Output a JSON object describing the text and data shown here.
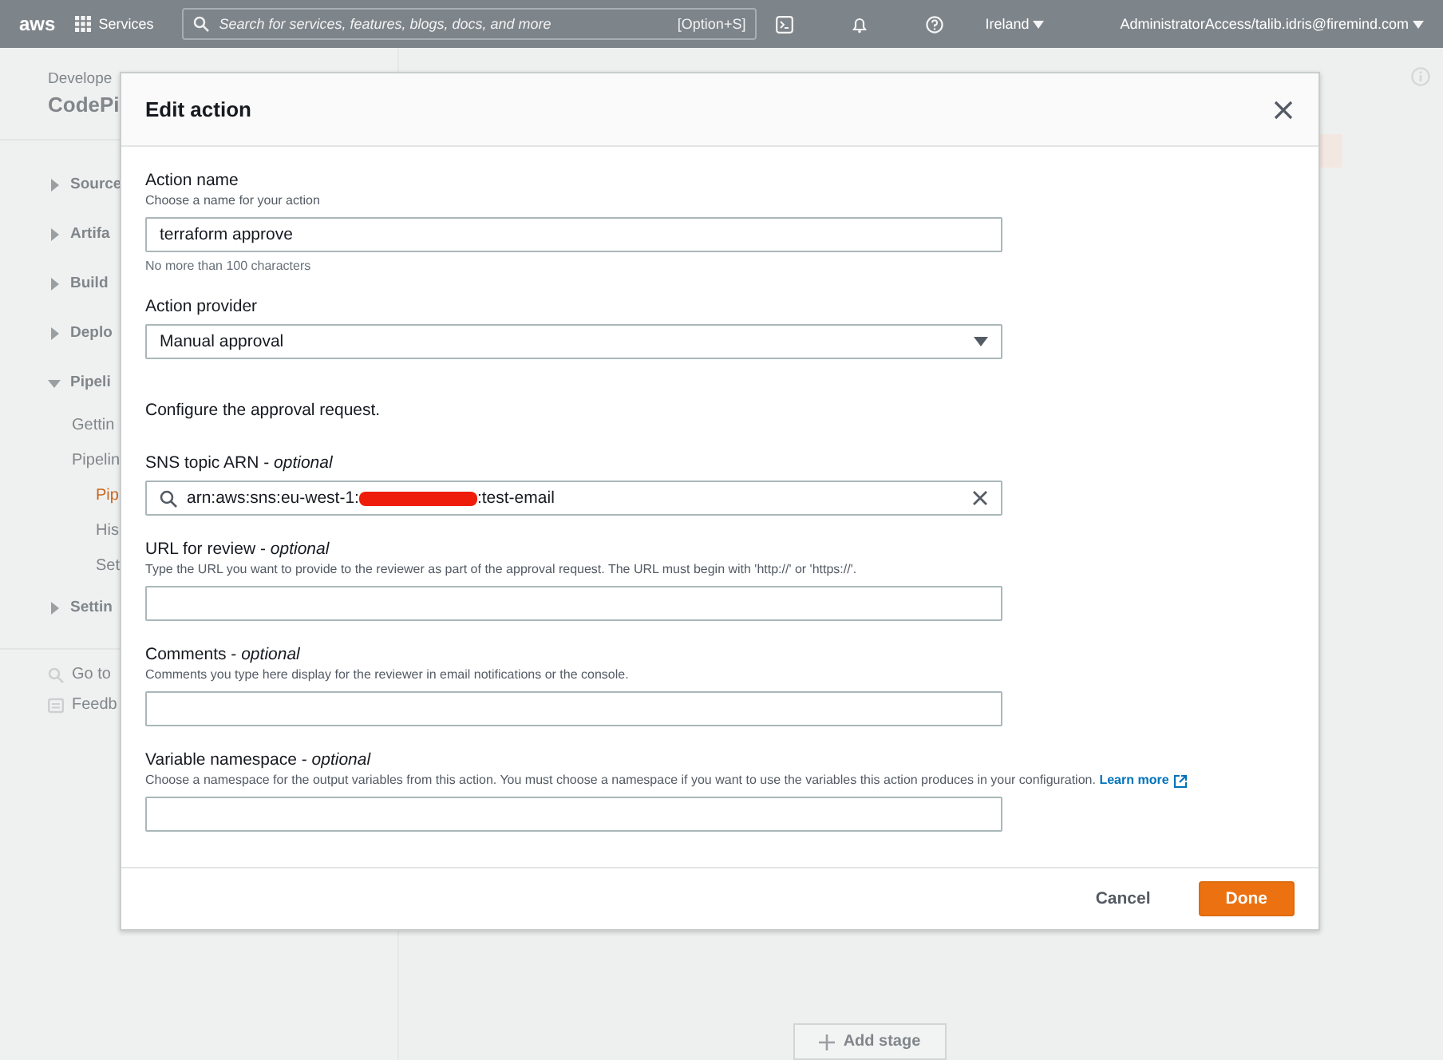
{
  "top_bar": {
    "logo": "aws",
    "services": "Services",
    "search_placeholder": "Search for services, features, blogs, docs, and more",
    "search_shortcut": "[Option+S]",
    "region": "Ireland",
    "account": "AdministratorAccess/talib.idris@firemind.com"
  },
  "sidebar": {
    "service": "Develope",
    "title": "CodePi",
    "items": [
      {
        "label": "Source",
        "expanded": false
      },
      {
        "label": "Artifa",
        "expanded": false
      },
      {
        "label": "Build",
        "expanded": false
      },
      {
        "label": "Deplo",
        "expanded": false
      },
      {
        "label": "Pipeli",
        "expanded": true,
        "children": [
          {
            "label": "Gettin",
            "selected": false
          },
          {
            "label": "Pipelin",
            "selected": false,
            "children": [
              {
                "label": "Pip",
                "selected": true
              },
              {
                "label": "His",
                "selected": false
              },
              {
                "label": "Set",
                "selected": false
              }
            ]
          }
        ]
      },
      {
        "label": "Settin",
        "expanded": false
      }
    ],
    "footer": [
      {
        "kind": "search",
        "label": "Go to"
      },
      {
        "kind": "feedback",
        "label": "Feedb"
      }
    ]
  },
  "main": {
    "add_stage": "Add stage"
  },
  "modal": {
    "title": "Edit action",
    "fields": [
      {
        "kind": "text",
        "label": "Action name",
        "description": "Choose a name for your action",
        "value": "terraform approve",
        "hint": "No more than 100 characters"
      },
      {
        "kind": "select",
        "label": "Action provider",
        "value": "Manual approval"
      },
      {
        "kind": "note",
        "text": "Configure the approval request."
      },
      {
        "kind": "search",
        "label": "SNS topic ARN - *optional*",
        "value_start": "arn:aws:sns:eu-west-1:",
        "redacted": true,
        "value_end": ":test-email"
      },
      {
        "kind": "text",
        "label": "URL for review - *optional*",
        "description": "Type the URL you want to provide to the reviewer as part of the approval request. The URL must begin with 'http://' or 'https://'."
      },
      {
        "kind": "text",
        "label": "Comments - *optional*",
        "description": "Comments you type here display for the reviewer in email notifications or the console."
      },
      {
        "kind": "text",
        "label": "Variable namespace - *optional*",
        "description": "Choose a namespace for the output variables from this action. You must choose a namespace if you want to use the variables this action produces in your configuration.",
        "link": "Learn more"
      }
    ],
    "buttons": [
      {
        "kind": "link",
        "label": "Cancel"
      },
      {
        "kind": "primary",
        "label": "Done"
      }
    ]
  }
}
